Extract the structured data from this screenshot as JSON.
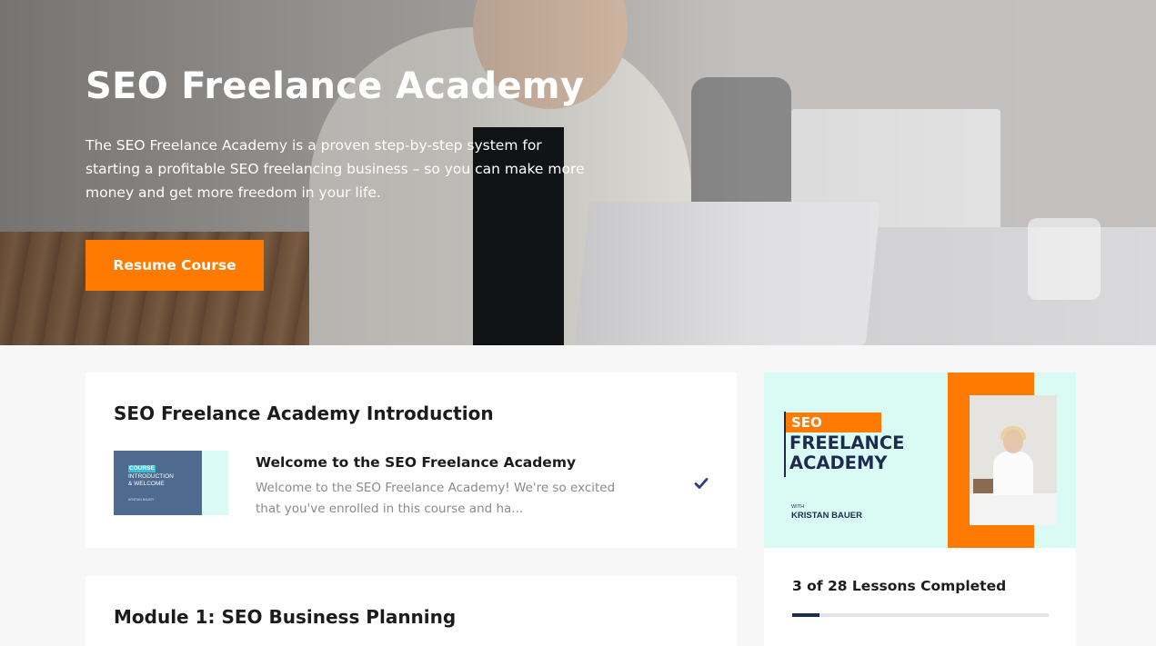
{
  "hero": {
    "title": "SEO Freelance Academy",
    "description": "The SEO Freelance Academy is a proven step-by-step system for starting a profitable SEO freelancing business – so you can make more money and get more freedom in your life.",
    "resume_label": "Resume Course"
  },
  "intro": {
    "title": "SEO Freelance Academy Introduction",
    "lesson": {
      "title": "Welcome to the SEO Freelance Academy",
      "description": "Welcome to the SEO Freelance Academy! We're so excited that you've enrolled in this course and ha...",
      "completed": true,
      "thumb_badge": "COURSE",
      "thumb_line2": "INTRODUCTION",
      "thumb_line3": "& WELCOME",
      "thumb_author": "KRISTAN BAUER"
    }
  },
  "module1": {
    "title": "Module 1: SEO Business Planning"
  },
  "sidebar": {
    "cover": {
      "seo": "SEO",
      "freelance": "FREELANCE",
      "academy": "ACADEMY",
      "with": "WITH",
      "author": "KRISTAN BAUER"
    },
    "progress_text": "3 of 28 Lessons Completed",
    "completed_lessons": 3,
    "total_lessons": 28
  },
  "colors": {
    "accent": "#ff7a00",
    "navy": "#1d2b4f",
    "check": "#2d3f73"
  }
}
